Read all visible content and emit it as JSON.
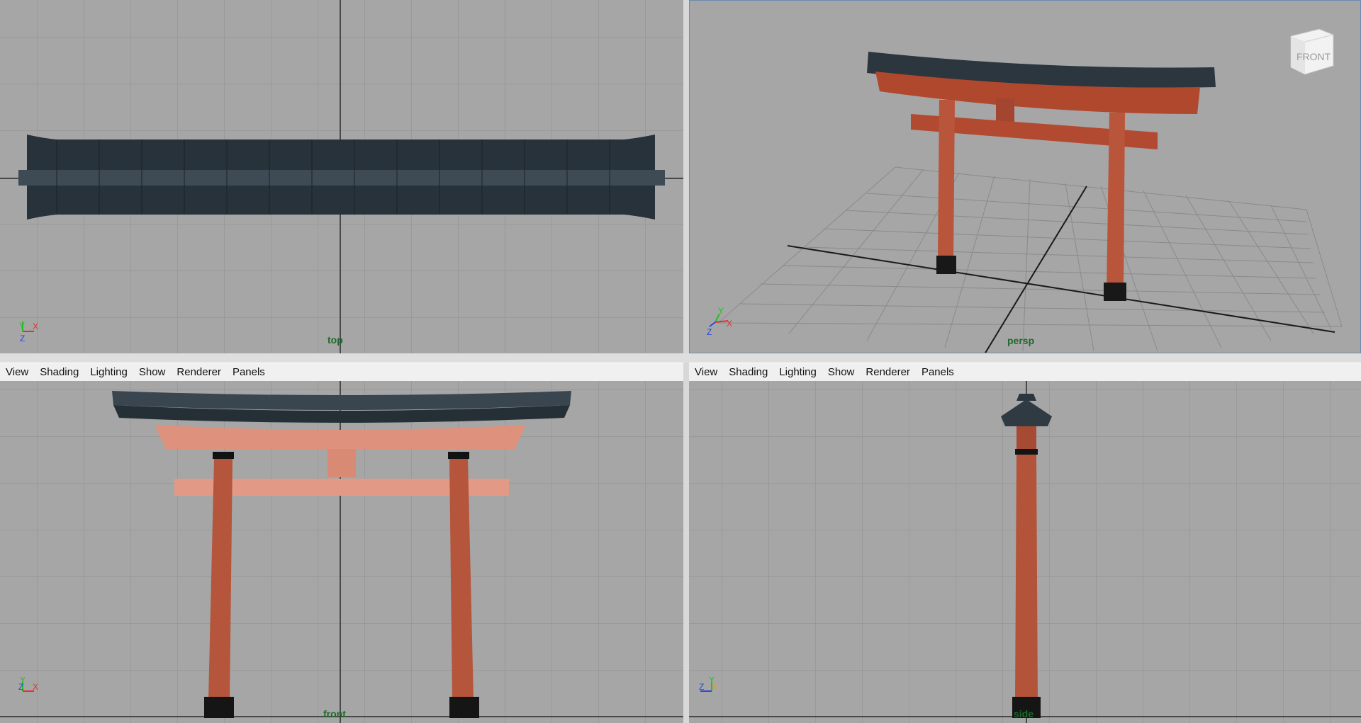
{
  "panels": {
    "top": {
      "label": "top"
    },
    "persp": {
      "label": "persp",
      "view_cube_face": "FRONT"
    },
    "front": {
      "label": "front"
    },
    "side": {
      "label": "side"
    }
  },
  "menu_left": [
    "View",
    "Shading",
    "Lighting",
    "Show",
    "Renderer",
    "Panels"
  ],
  "menu_right": [
    "View",
    "Shading",
    "Lighting",
    "Show",
    "Renderer",
    "Panels"
  ],
  "axis_labels": {
    "x": "X",
    "y": "Y",
    "z": "Z"
  },
  "colors": {
    "viewport_bg": "#a6a6a6",
    "grid_line": "#8f8f8f",
    "axis_line": "#2a2a2a",
    "roof": "#2c3840",
    "pillar": "#b3543a",
    "beam_front": "#dd8f7a",
    "label_green": "#1d6a2a",
    "axis_x": "#e53030",
    "axis_y": "#22c022",
    "axis_z": "#2a4ad8"
  }
}
